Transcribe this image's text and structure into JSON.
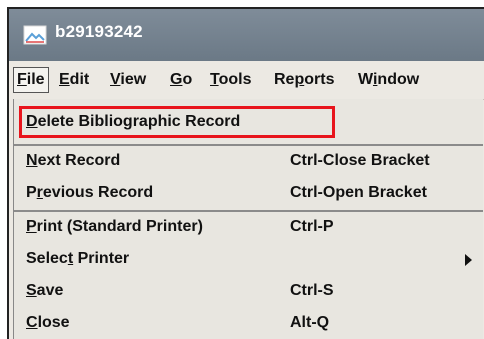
{
  "window": {
    "title": "b29193242",
    "icon": "record-window-icon"
  },
  "menubar": {
    "items": [
      {
        "label": "File",
        "mnemonic": "F",
        "rest": "ile",
        "open": true
      },
      {
        "label": "Edit",
        "mnemonic": "E",
        "rest": "dit"
      },
      {
        "label": "View",
        "mnemonic": "V",
        "rest": "iew"
      },
      {
        "label": "Go",
        "mnemonic": "G",
        "rest": "o"
      },
      {
        "label": "Tools",
        "mnemonic": "T",
        "rest": "ools"
      },
      {
        "label": "Reports",
        "pre": "Re",
        "mnemonic": "p",
        "rest": "orts"
      },
      {
        "label": "Window",
        "pre": "W",
        "mnemonic": "i",
        "rest": "ndow"
      }
    ]
  },
  "file_menu": {
    "items": [
      {
        "pre": "",
        "mnemonic": "D",
        "rest": "elete Bibliographic Record",
        "shortcut": "",
        "highlighted": true
      },
      {
        "pre": "",
        "mnemonic": "N",
        "rest": "ext Record",
        "shortcut": "Ctrl-Close Bracket"
      },
      {
        "pre": "P",
        "mnemonic": "r",
        "rest": "evious Record",
        "shortcut": "Ctrl-Open Bracket"
      },
      {
        "pre": "",
        "mnemonic": "P",
        "rest": "rint (Standard Printer)",
        "shortcut": "Ctrl-P"
      },
      {
        "pre": "Selec",
        "mnemonic": "t",
        "rest": " Printer",
        "shortcut": "",
        "submenu": true
      },
      {
        "pre": "",
        "mnemonic": "S",
        "rest": "ave",
        "shortcut": "Ctrl-S"
      },
      {
        "pre": "",
        "mnemonic": "C",
        "rest": "lose",
        "shortcut": "Alt-Q"
      }
    ]
  },
  "annotation": {
    "highlight_color": "#e8141c"
  }
}
